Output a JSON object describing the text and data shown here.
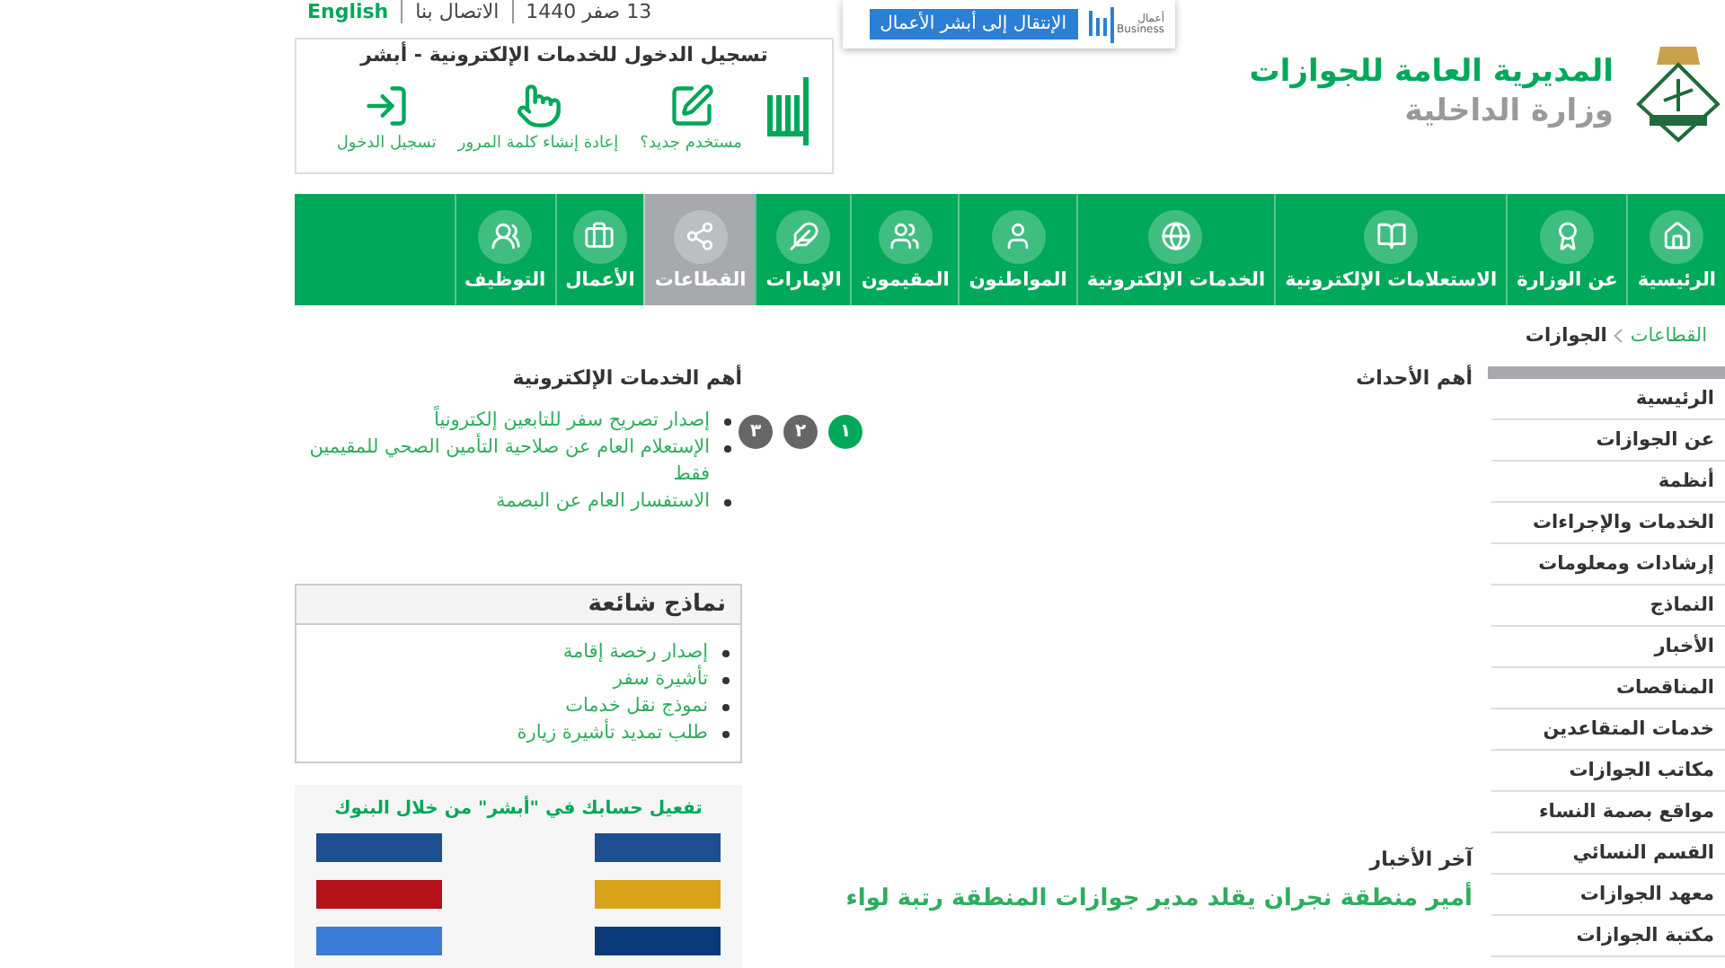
{
  "popup": {
    "logo_word": "أعمال",
    "logo_sub": "Business",
    "button": "الإنتقال إلى أبشر الأعمال"
  },
  "top_links": [
    {
      "label": "13 صفر 1440",
      "kind": "text"
    },
    {
      "label": "الاتصال بنا",
      "kind": "link"
    },
    {
      "label": "English",
      "kind": "lang"
    }
  ],
  "login_box": {
    "title": "تسجيل الدخول للخدمات الإلكترونية - أبشر",
    "actions": [
      {
        "label": "مستخدم جديد؟"
      },
      {
        "label": "إعادة إنشاء كلمة المرور"
      },
      {
        "label": "تسجيل الدخول"
      }
    ]
  },
  "site": {
    "title": "المديرية العامة للجوازات",
    "subtitle": "وزارة الداخلية"
  },
  "nav": [
    {
      "label": "الرئيسية",
      "selected": false
    },
    {
      "label": "عن الوزارة",
      "selected": false
    },
    {
      "label": "الاستعلامات الإلكترونية",
      "selected": false
    },
    {
      "label": "الخدمات الإلكترونية",
      "selected": false
    },
    {
      "label": "المواطنون",
      "selected": false
    },
    {
      "label": "المقيمون",
      "selected": false
    },
    {
      "label": "الإمارات",
      "selected": false
    },
    {
      "label": "القطاعات",
      "selected": true
    },
    {
      "label": "الأعمال",
      "selected": false
    },
    {
      "label": "التوظيف",
      "selected": false
    }
  ],
  "breadcrumb": [
    {
      "label": "القطاعات",
      "kind": "link"
    },
    {
      "label": "الجوازات",
      "kind": "current"
    }
  ],
  "sidebar": {
    "items": [
      {
        "label": "الرئيسية"
      },
      {
        "label": "عن الجوازات"
      },
      {
        "label": "أنظمة"
      },
      {
        "label": "الخدمات والإجراءات"
      },
      {
        "label": "إرشادات ومعلومات"
      },
      {
        "label": "النماذج"
      },
      {
        "label": "الأخبار"
      },
      {
        "label": "المناقصات"
      },
      {
        "label": "خدمات المتقاعدين"
      },
      {
        "label": "مكاتب الجوازات"
      },
      {
        "label": "مواقع بصمة النساء"
      },
      {
        "label": "القسم النسائي"
      },
      {
        "label": "معهد الجوازات"
      },
      {
        "label": "مكتبة الجوازات"
      }
    ]
  },
  "events": {
    "title": "أهم الأحداث",
    "slides": [
      {
        "label": "١",
        "selected": true
      },
      {
        "label": "٢",
        "selected": false
      },
      {
        "label": "٣",
        "selected": false
      }
    ]
  },
  "news": {
    "title": "آخر الأخبار",
    "headline": "أمير منطقة نجران يقلد مدير جوازات المنطقة رتبة لواء"
  },
  "eservices": {
    "title": "أهم الخدمات الإلكترونية",
    "items": [
      "إصدار تصريح سفر للتابعين إلكترونياً",
      "الإستعلام العام عن صلاحية التأمين الصحي للمقيمين فقط",
      "الاستفسار العام عن البصمة"
    ]
  },
  "forms": {
    "title": "نماذج شائعة",
    "items": [
      "إصدار رخصة إقامة",
      "تأشيرة سفر",
      "نموذج نقل خدمات",
      "طلب تمديد تأشيرة زيارة"
    ]
  },
  "banks_banner": {
    "title": "تفعيل حسابك في \"أبشر\" من خلال البنوك"
  }
}
